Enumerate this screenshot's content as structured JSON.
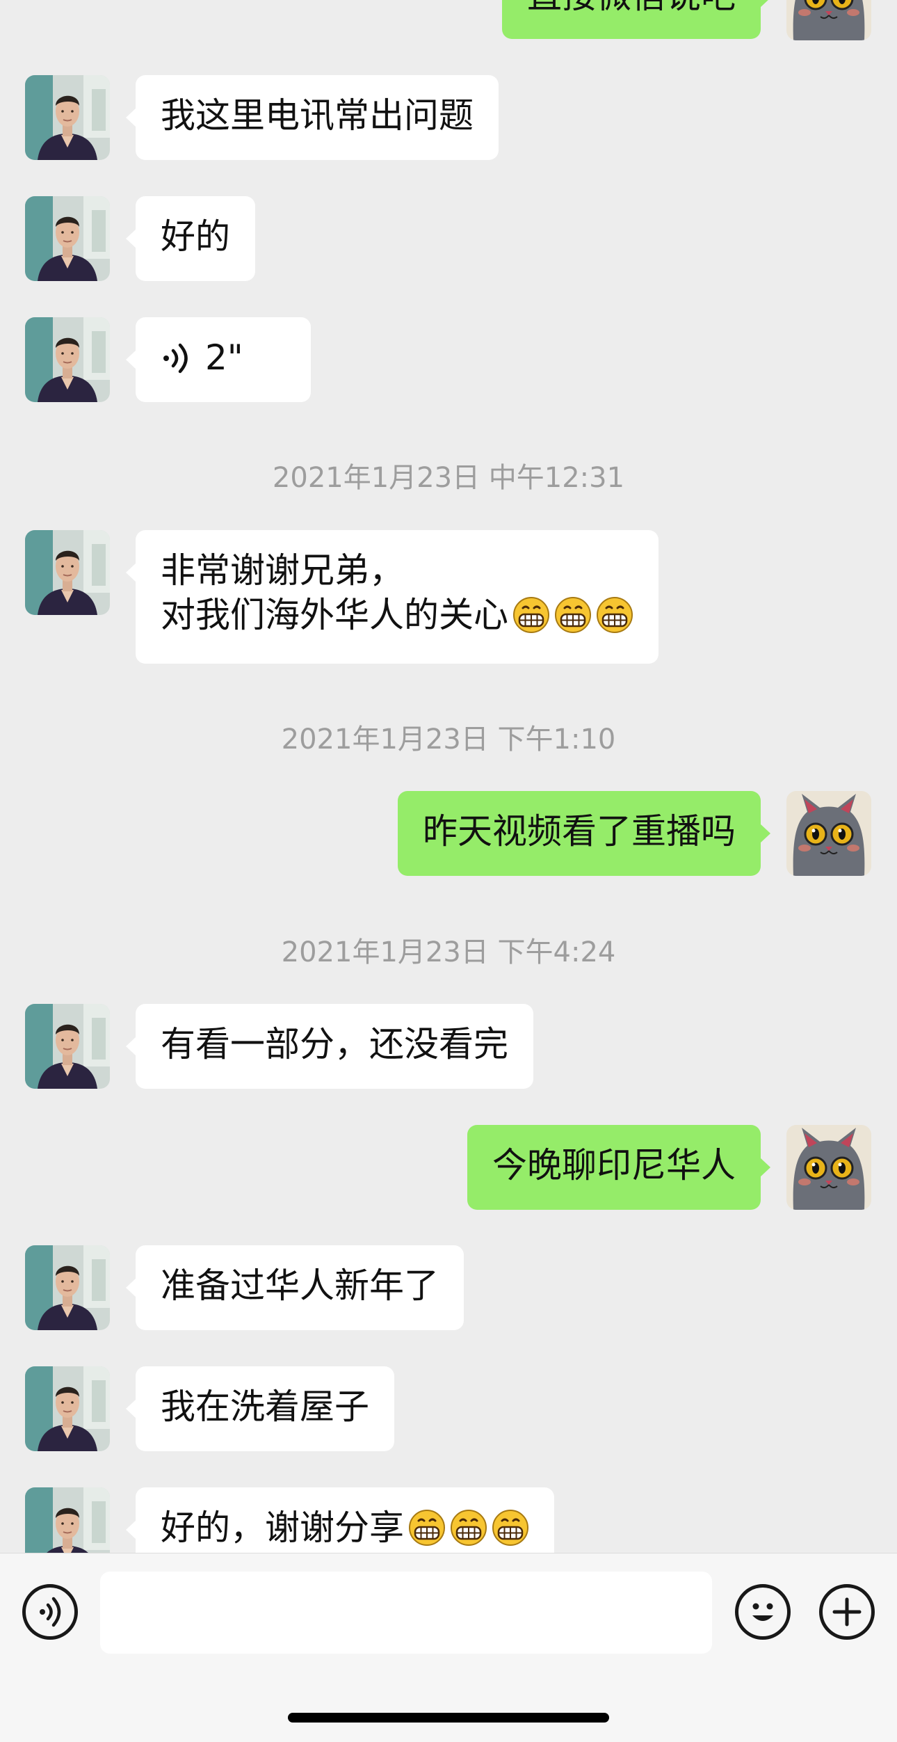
{
  "messages": [
    {
      "side": "out",
      "text": "直接微信说吧"
    },
    {
      "side": "in",
      "text": "我这里电讯常出问题"
    },
    {
      "side": "in",
      "text": "好的"
    },
    {
      "side": "in",
      "voice_duration": "2\""
    },
    {
      "timestamp": "2021年1月23日 中午12:31"
    },
    {
      "side": "in",
      "lines": [
        "非常谢谢兄弟，",
        "对我们海外华人的关心"
      ],
      "emoji": "grinning-emoji x3"
    },
    {
      "timestamp": "2021年1月23日 下午1:10"
    },
    {
      "side": "out",
      "text": "昨天视频看了重播吗"
    },
    {
      "timestamp": "2021年1月23日 下午4:24"
    },
    {
      "side": "in",
      "text": "有看一部分，还没看完"
    },
    {
      "side": "out",
      "text": "今晚聊印尼华人"
    },
    {
      "side": "in",
      "text": "准备过华人新年了"
    },
    {
      "side": "in",
      "text": "我在洗着屋子"
    },
    {
      "side": "in",
      "text": "好的，谢谢分享",
      "emoji": "grinning-emoji x3"
    }
  ],
  "m": {
    "m0": "直接微信说吧",
    "m1": "我这里电讯常出问题",
    "m2": "好的",
    "m3_voice": "2\"",
    "t1": "2021年1月23日 中午12:31",
    "m4_line1": "非常谢谢兄弟，",
    "m4_line2": "对我们海外华人的关心",
    "t2": "2021年1月23日 下午1:10",
    "m5": "昨天视频看了重播吗",
    "t3": "2021年1月23日 下午4:24",
    "m6": "有看一部分，还没看完",
    "m7": "今晚聊印尼华人",
    "m8": "准备过华人新年了",
    "m9": "我在洗着屋子",
    "m10": "好的，谢谢分享"
  },
  "input_bar": {
    "voice_icon": "voice-toggle-icon",
    "emoji_icon": "emoji-smile-icon",
    "plus_icon": "plus-icon",
    "text_value": ""
  },
  "colors": {
    "background": "#ededed",
    "incoming_bubble": "#ffffff",
    "outgoing_bubble": "#95ec69",
    "timestamp_text": "#9d9d9d"
  }
}
